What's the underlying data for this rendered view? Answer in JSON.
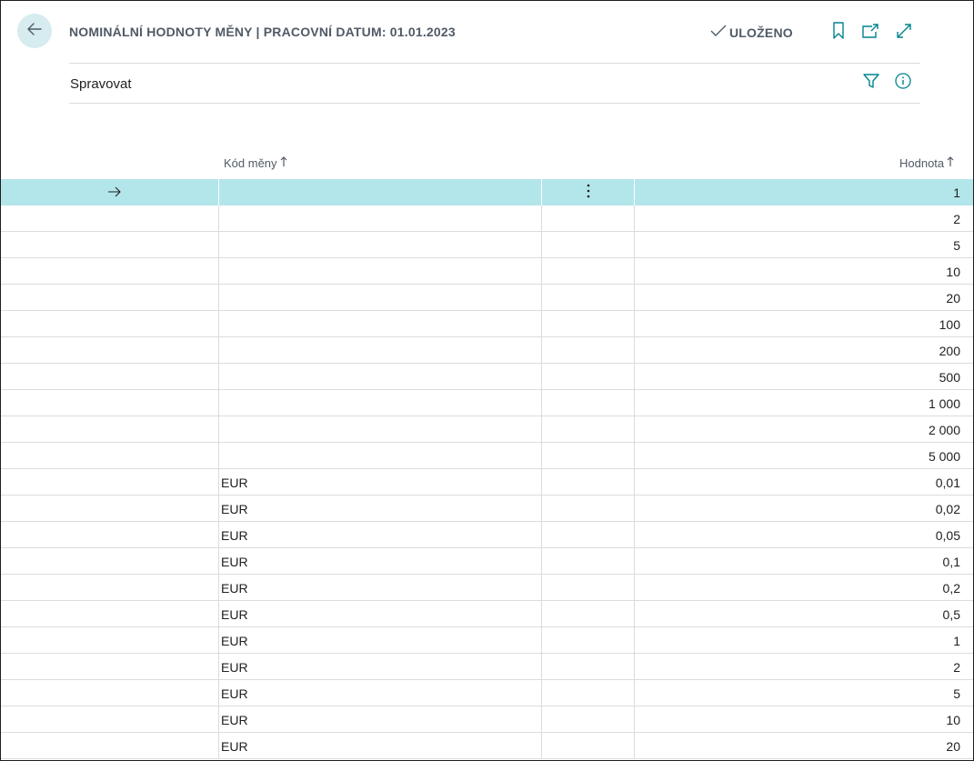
{
  "header": {
    "title": "NOMINÁLNÍ HODNOTY MĚNY | PRACOVNÍ DATUM: 01.01.2023",
    "saved_label": "ULOŽENO"
  },
  "actions": {
    "manage_label": "Spravovat"
  },
  "columns": {
    "currency_code": "Kód měny",
    "value": "Hodnota"
  },
  "rows": [
    {
      "code": "",
      "value": "1"
    },
    {
      "code": "",
      "value": "2"
    },
    {
      "code": "",
      "value": "5"
    },
    {
      "code": "",
      "value": "10"
    },
    {
      "code": "",
      "value": "20"
    },
    {
      "code": "",
      "value": "100"
    },
    {
      "code": "",
      "value": "200"
    },
    {
      "code": "",
      "value": "500"
    },
    {
      "code": "",
      "value": "1 000"
    },
    {
      "code": "",
      "value": "2 000"
    },
    {
      "code": "",
      "value": "5 000"
    },
    {
      "code": "EUR",
      "value": "0,01"
    },
    {
      "code": "EUR",
      "value": "0,02"
    },
    {
      "code": "EUR",
      "value": "0,05"
    },
    {
      "code": "EUR",
      "value": "0,1"
    },
    {
      "code": "EUR",
      "value": "0,2"
    },
    {
      "code": "EUR",
      "value": "0,5"
    },
    {
      "code": "EUR",
      "value": "1"
    },
    {
      "code": "EUR",
      "value": "2"
    },
    {
      "code": "EUR",
      "value": "5"
    },
    {
      "code": "EUR",
      "value": "10"
    },
    {
      "code": "EUR",
      "value": "20"
    }
  ],
  "icons": {
    "back": "arrow-left-icon",
    "saved": "checkmark-icon",
    "bookmark": "bookmark-icon",
    "share": "open-in-new-icon",
    "expand": "expand-icon",
    "filter": "filter-icon",
    "info": "info-icon",
    "row_arrow": "arrow-right-icon",
    "row_menu": "more-vertical-icon",
    "sort": "sort-up-icon"
  },
  "colors": {
    "accent": "#00838f",
    "selected_row": "#b3e6ea",
    "back_button": "#d6ecef"
  }
}
